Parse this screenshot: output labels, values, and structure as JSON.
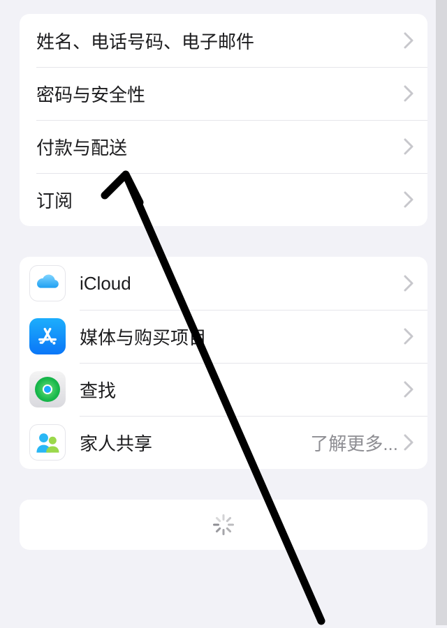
{
  "group1": {
    "items": [
      {
        "label": "姓名、电话号码、电子邮件"
      },
      {
        "label": "密码与安全性"
      },
      {
        "label": "付款与配送"
      },
      {
        "label": "订阅"
      }
    ]
  },
  "group2": {
    "items": [
      {
        "label": "iCloud",
        "detail": ""
      },
      {
        "label": "媒体与购买项目",
        "detail": ""
      },
      {
        "label": "查找",
        "detail": ""
      },
      {
        "label": "家人共享",
        "detail": "了解更多..."
      }
    ]
  }
}
